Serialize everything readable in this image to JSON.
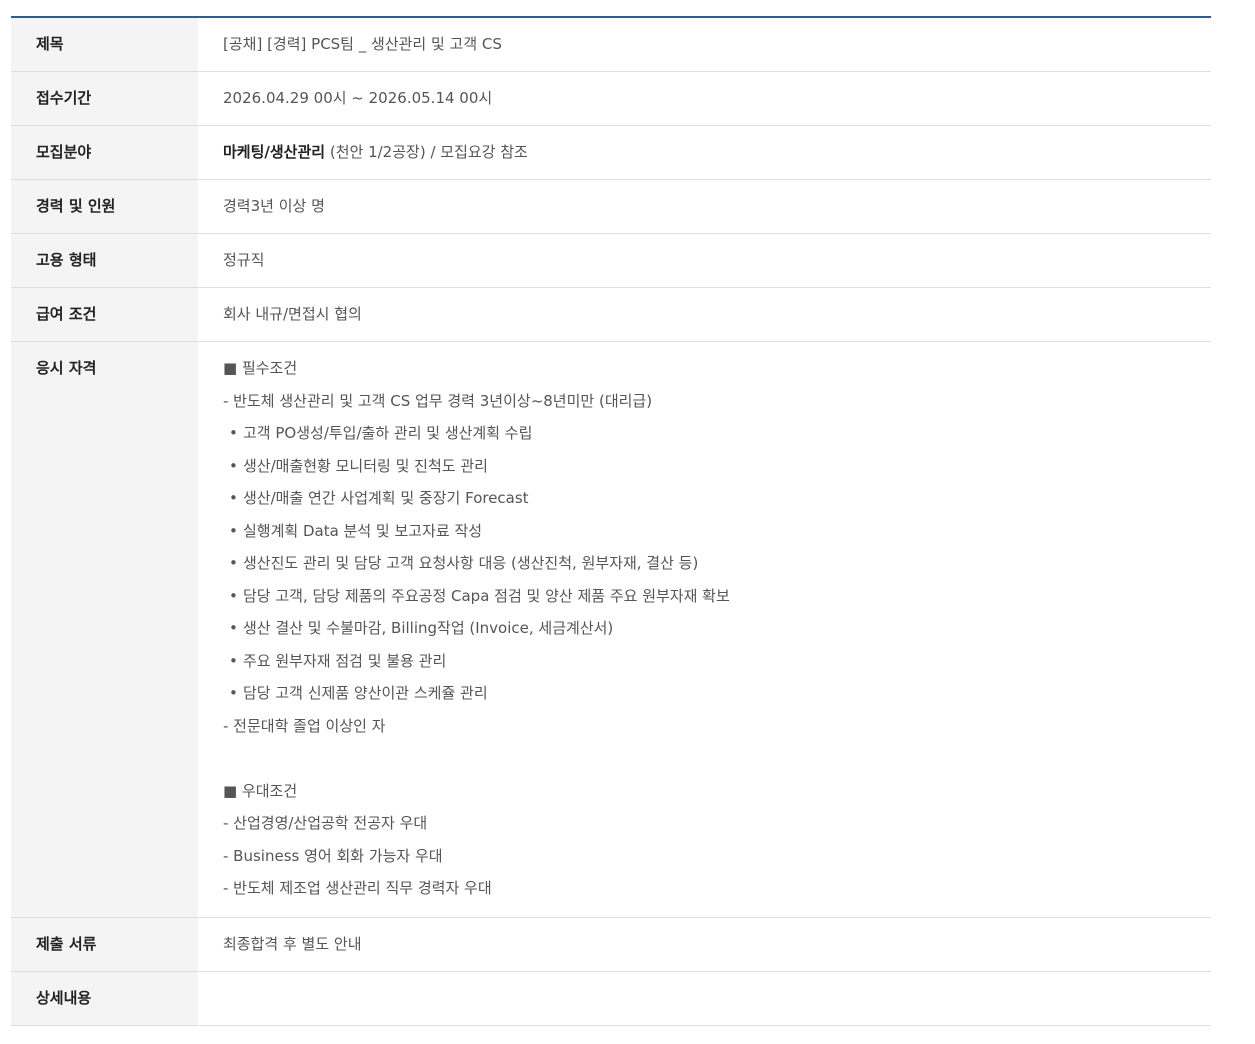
{
  "rows": {
    "title": {
      "label": "제목",
      "value": "[공채] [경력] PCS팀 _ 생산관리 및 고객 CS"
    },
    "period": {
      "label": "접수기간",
      "value": "2026.04.29 00시 ~ 2026.05.14 00시"
    },
    "field": {
      "label": "모집분야",
      "value_strong": "마케팅/생산관리",
      "value_rest": " (천안 1/2공장) / 모집요강 참조"
    },
    "experience": {
      "label": "경력 및 인원",
      "value": "경력3년 이상 명"
    },
    "employment": {
      "label": "고용 형태",
      "value": "정규직"
    },
    "salary": {
      "label": "급여 조건",
      "value": "회사 내규/면접시 협의"
    },
    "qualification": {
      "label": "응시 자격",
      "required_head": "■ 필수조건",
      "required_intro": "- 반도체 생산관리 및 고객 CS 업무 경력 3년이상~8년미만 (대리급)",
      "bullet_char": "•",
      "bullets": [
        "고객 PO생성/투입/출하 관리 및 생산계획 수립",
        "생산/매출현황 모니터링 및 진척도 관리",
        "생산/매출 연간 사업계획 및 중장기 Forecast",
        "실행계획 Data 분석 및 보고자료 작성",
        "생산진도 관리 및 담당 고객 요청사항 대응 (생산진척, 원부자재, 결산 등)",
        "담당 고객, 담당 제품의 주요공정 Capa 점검 및 양산 제품 주요 원부자재 확보",
        "생산 결산 및 수불마감, Billing작업 (Invoice, 세금계산서)",
        "주요 원부자재 점검 및 불용 관리",
        "담당 고객 신제품 양산이관 스케쥴 관리"
      ],
      "required_outro": "- 전문대학 졸업 이상인 자",
      "preferred_head": "■ 우대조건",
      "preferred": [
        "- 산업경영/산업공학 전공자 우대",
        "- Business 영어 회화 가능자 우대",
        "- 반도체 제조업 생산관리 직무 경력자 우대"
      ]
    },
    "documents": {
      "label": "제출 서류",
      "value": "최종합격 후 별도 안내"
    },
    "details": {
      "label": "상세내용",
      "value": ""
    }
  },
  "colors": {
    "top_border": "#2f5a93",
    "label_bg": "#f4f4f4",
    "row_border": "#dedede"
  }
}
